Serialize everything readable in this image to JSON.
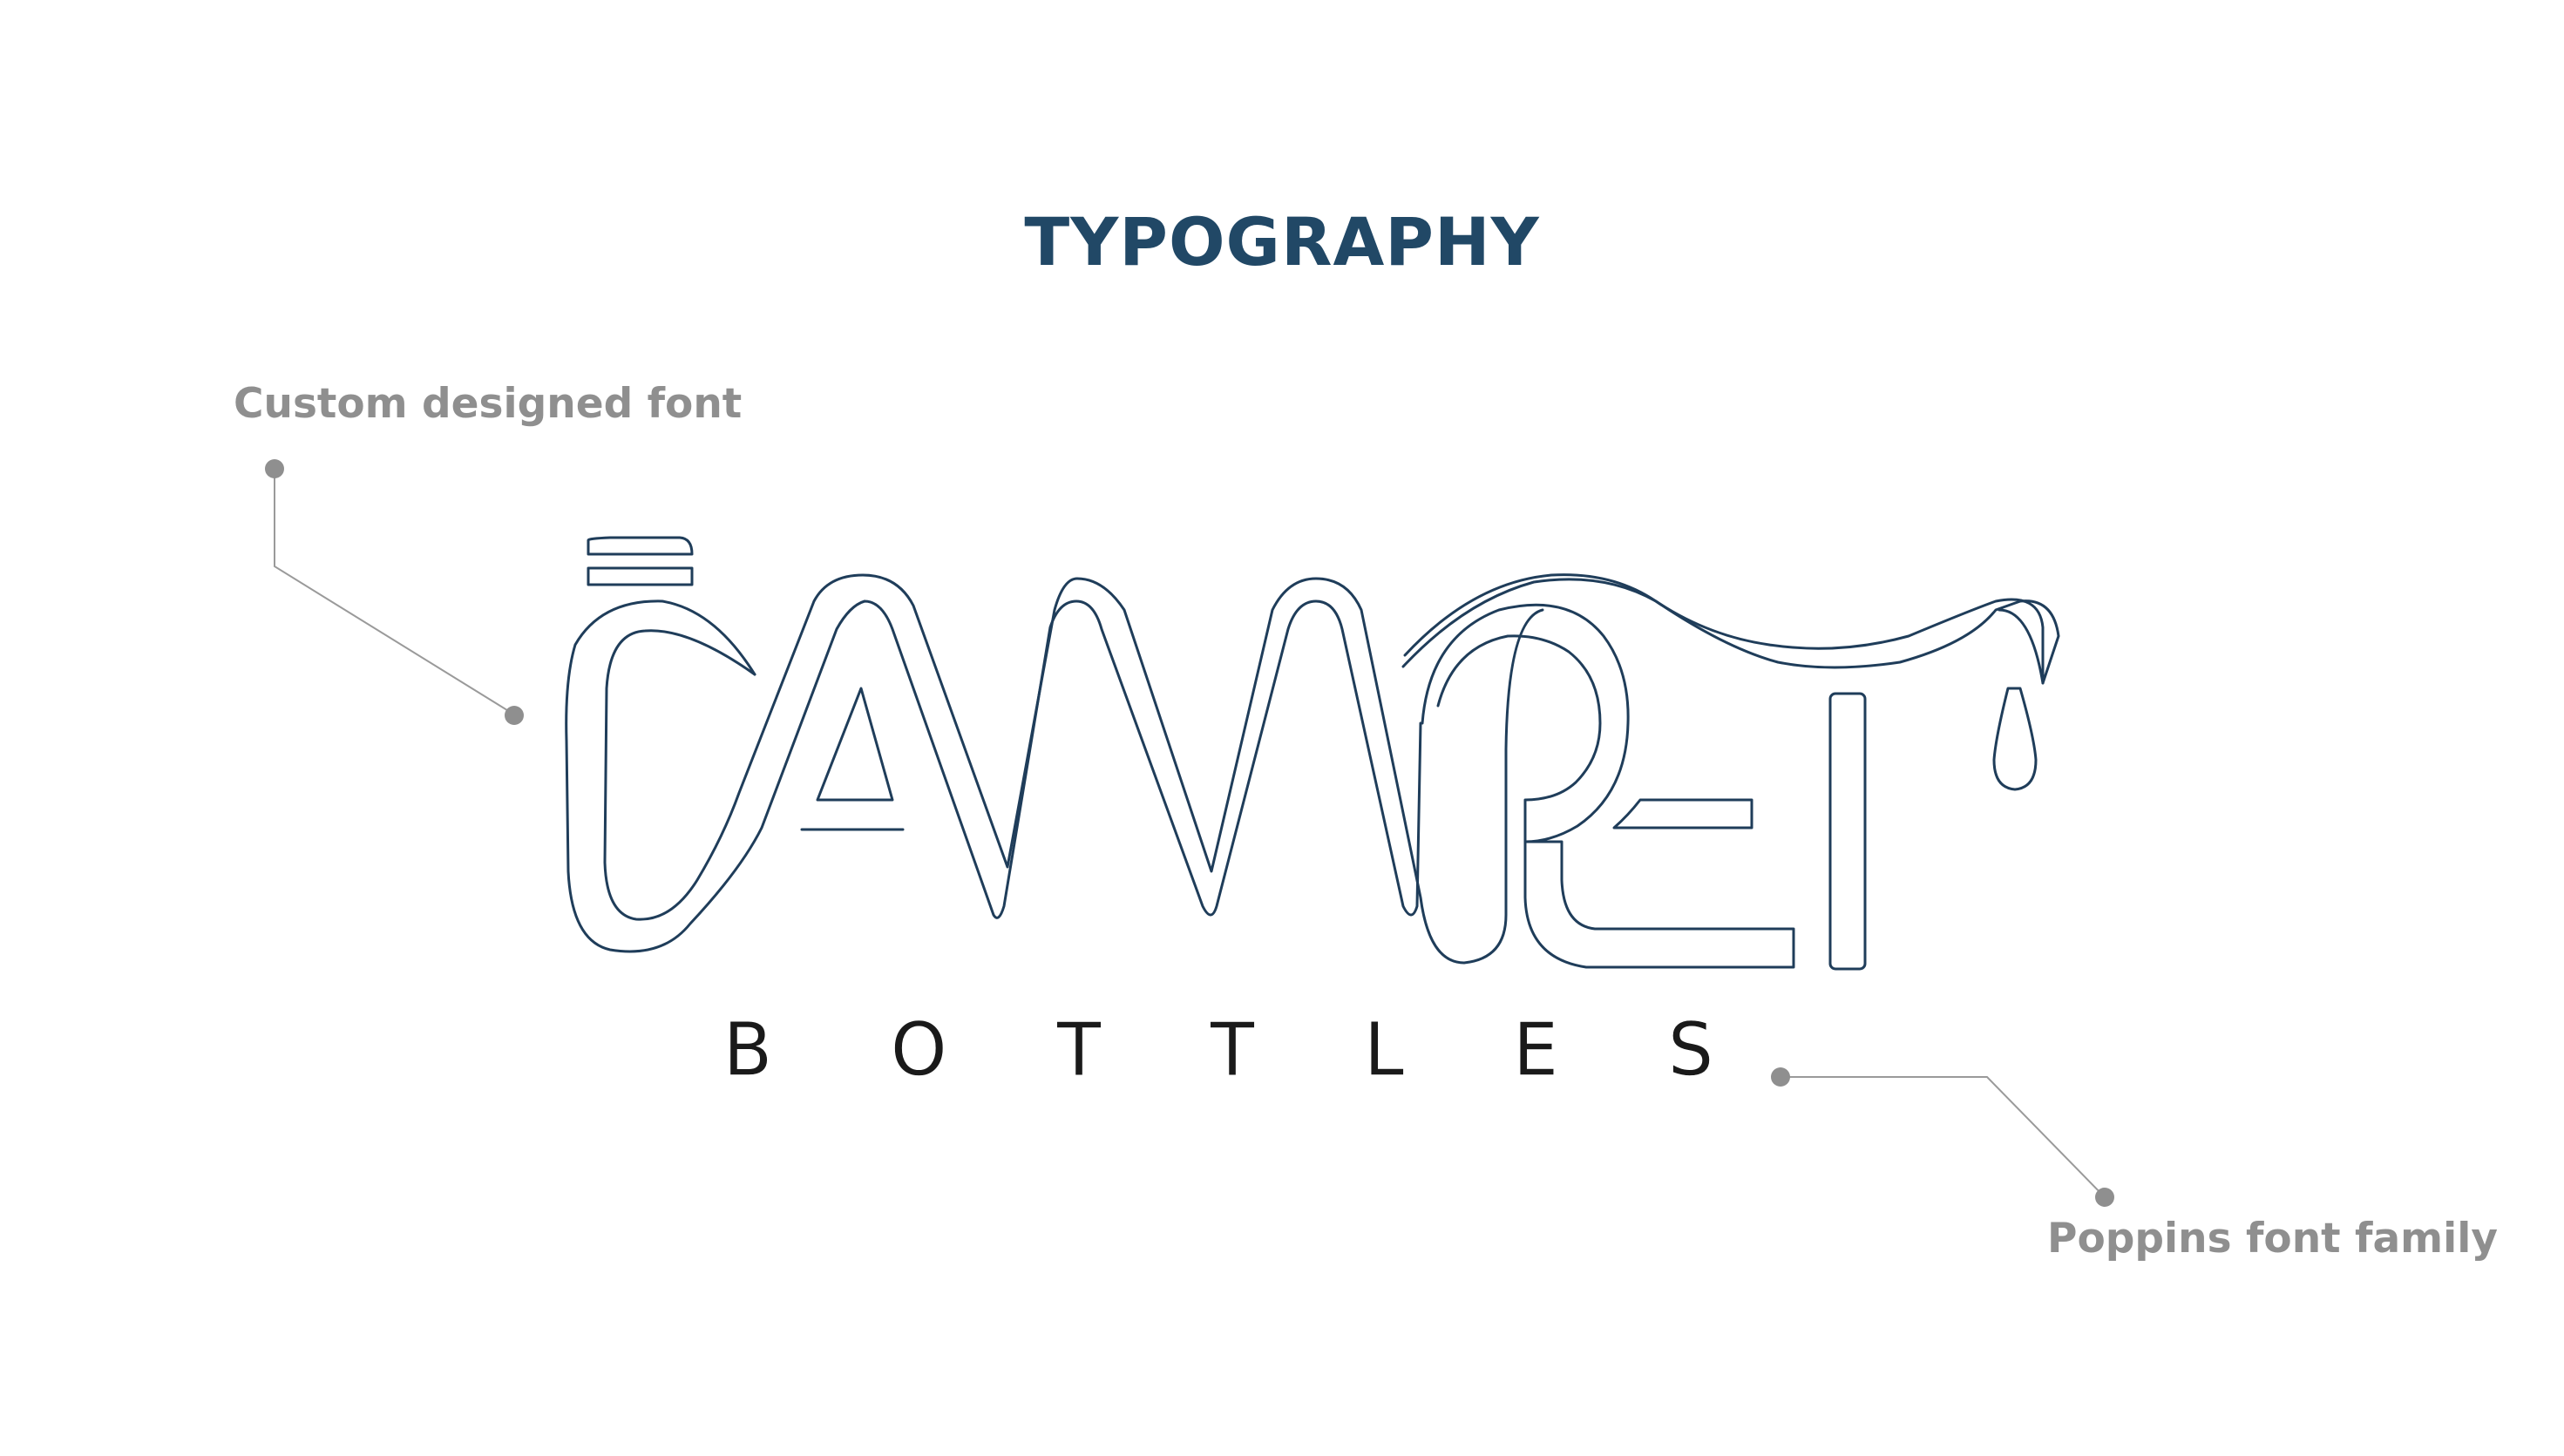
{
  "slide": {
    "title": "TYPOGRAPHY",
    "annotation_left": "Custom designed font",
    "annotation_right": "Poppins font family"
  },
  "logo": {
    "wordmark_subtitle_letters": [
      "B",
      "O",
      "T",
      "T",
      "L",
      "E",
      "S"
    ]
  },
  "colors": {
    "title": "#214866",
    "annotation": "#8f8f8f",
    "logo_stroke": "#1f3d5a",
    "subtitle": "#1a1a1a",
    "leader_line": "#9a9a9a",
    "leader_dot": "#8f8f8f",
    "background": "#ffffff"
  }
}
